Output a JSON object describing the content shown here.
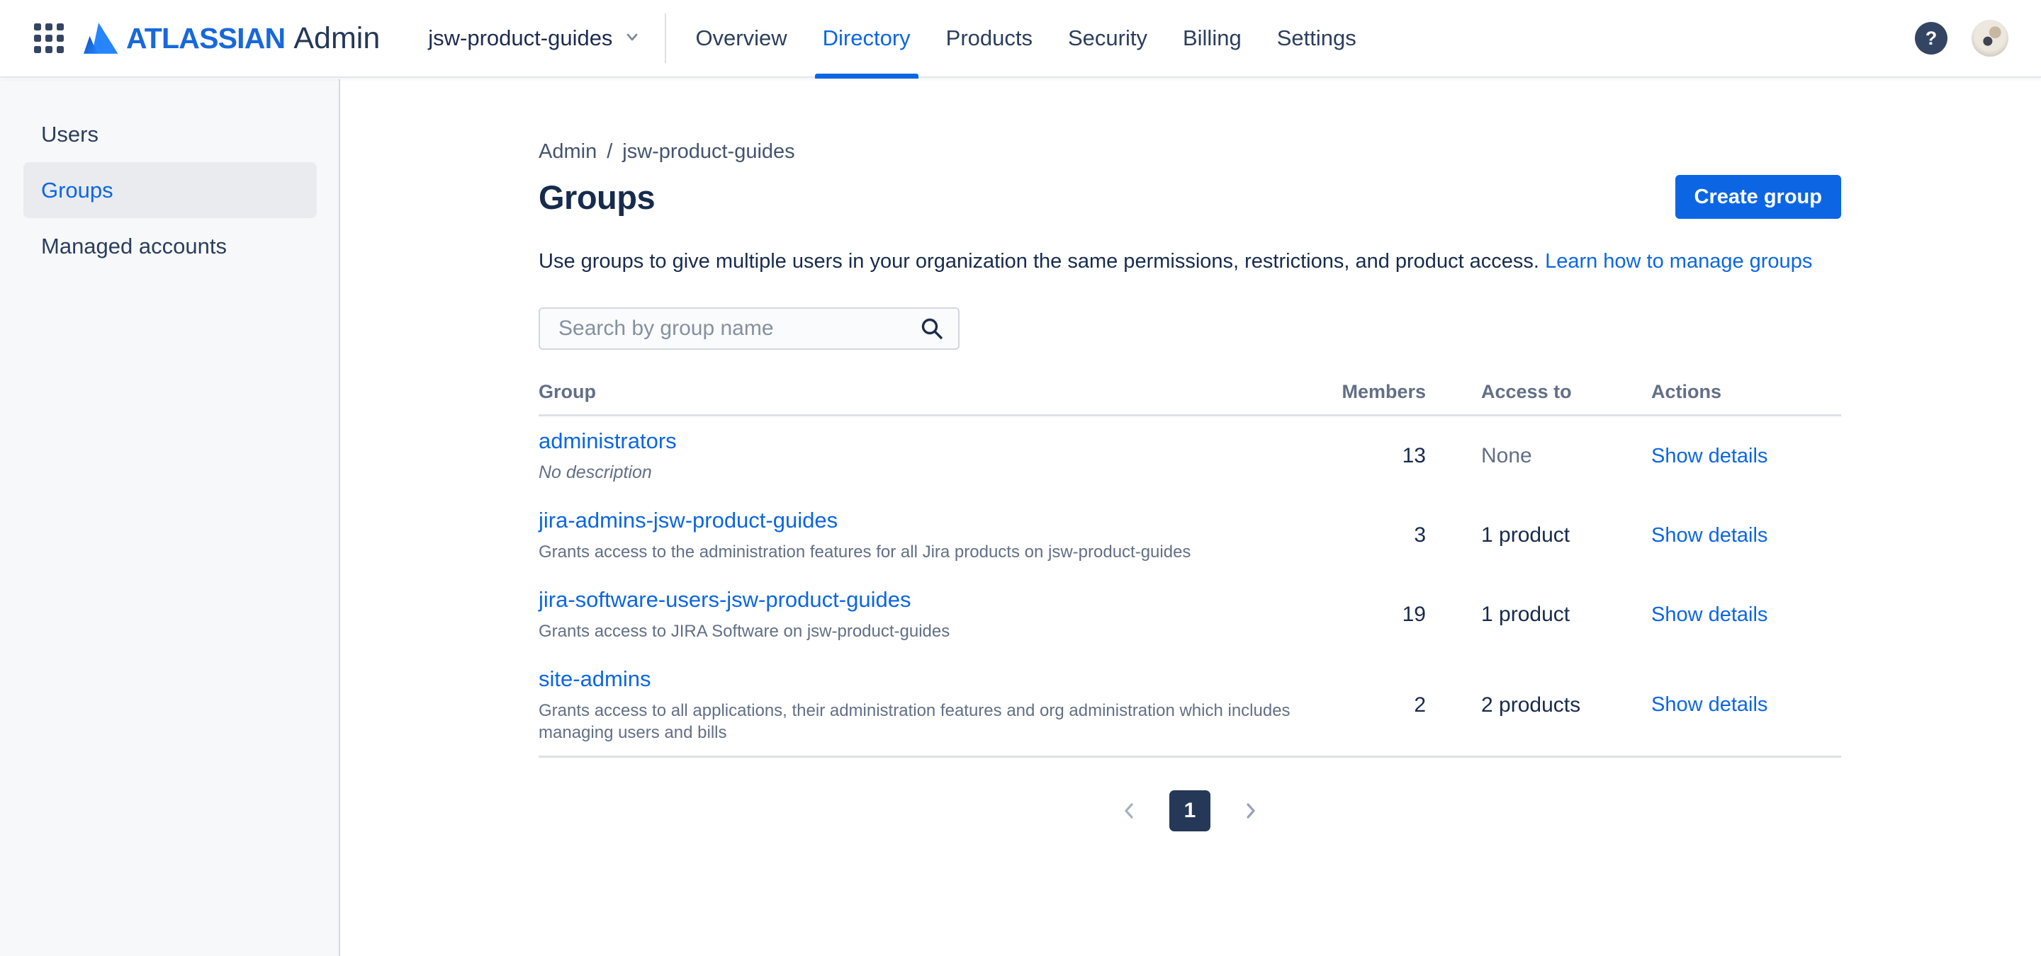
{
  "header": {
    "brand": {
      "wordmark": "ATLASSIAN",
      "product": "Admin"
    },
    "org_switcher": {
      "label": "jsw-product-guides"
    },
    "nav": [
      {
        "label": "Overview"
      },
      {
        "label": "Directory",
        "active": true
      },
      {
        "label": "Products"
      },
      {
        "label": "Security"
      },
      {
        "label": "Billing"
      },
      {
        "label": "Settings"
      }
    ],
    "help_glyph": "?"
  },
  "sidebar": {
    "items": [
      {
        "label": "Users",
        "selected": false
      },
      {
        "label": "Groups",
        "selected": true
      },
      {
        "label": "Managed accounts",
        "selected": false
      }
    ]
  },
  "main": {
    "breadcrumb": {
      "items": [
        "Admin",
        "jsw-product-guides"
      ],
      "separator": "/"
    },
    "title": "Groups",
    "create_button": "Create group",
    "description": "Use groups to give multiple users in your organization the same permissions, restrictions, and product access.",
    "learn_link": "Learn how to manage groups",
    "search": {
      "placeholder": "Search by group name"
    },
    "table": {
      "columns": [
        "Group",
        "Members",
        "Access to",
        "Actions"
      ],
      "rows": [
        {
          "name": "administrators",
          "description": "No description",
          "description_empty": true,
          "members": "13",
          "access": "None",
          "access_muted": true,
          "action": "Show details"
        },
        {
          "name": "jira-admins-jsw-product-guides",
          "description": "Grants access to the administration features for all Jira products on jsw-product-guides",
          "members": "3",
          "access": "1 product",
          "action": "Show details"
        },
        {
          "name": "jira-software-users-jsw-product-guides",
          "description": "Grants access to JIRA Software on jsw-product-guides",
          "members": "19",
          "access": "1 product",
          "action": "Show details"
        },
        {
          "name": "site-admins",
          "description": "Grants access to all applications, their administration features and org administration which includes managing users and bills",
          "members": "2",
          "access": "2 products",
          "action": "Show details"
        }
      ]
    },
    "pagination": {
      "current": "1"
    }
  },
  "colors": {
    "accent": "#0C66E4",
    "brand_blue": "#1868DB",
    "navy_text": "#172B4D",
    "muted_text": "#626F86",
    "selected_page_bg": "#253858",
    "sidebar_bg": "#F7F8F9",
    "selected_item_bg": "#E9EBEF"
  }
}
